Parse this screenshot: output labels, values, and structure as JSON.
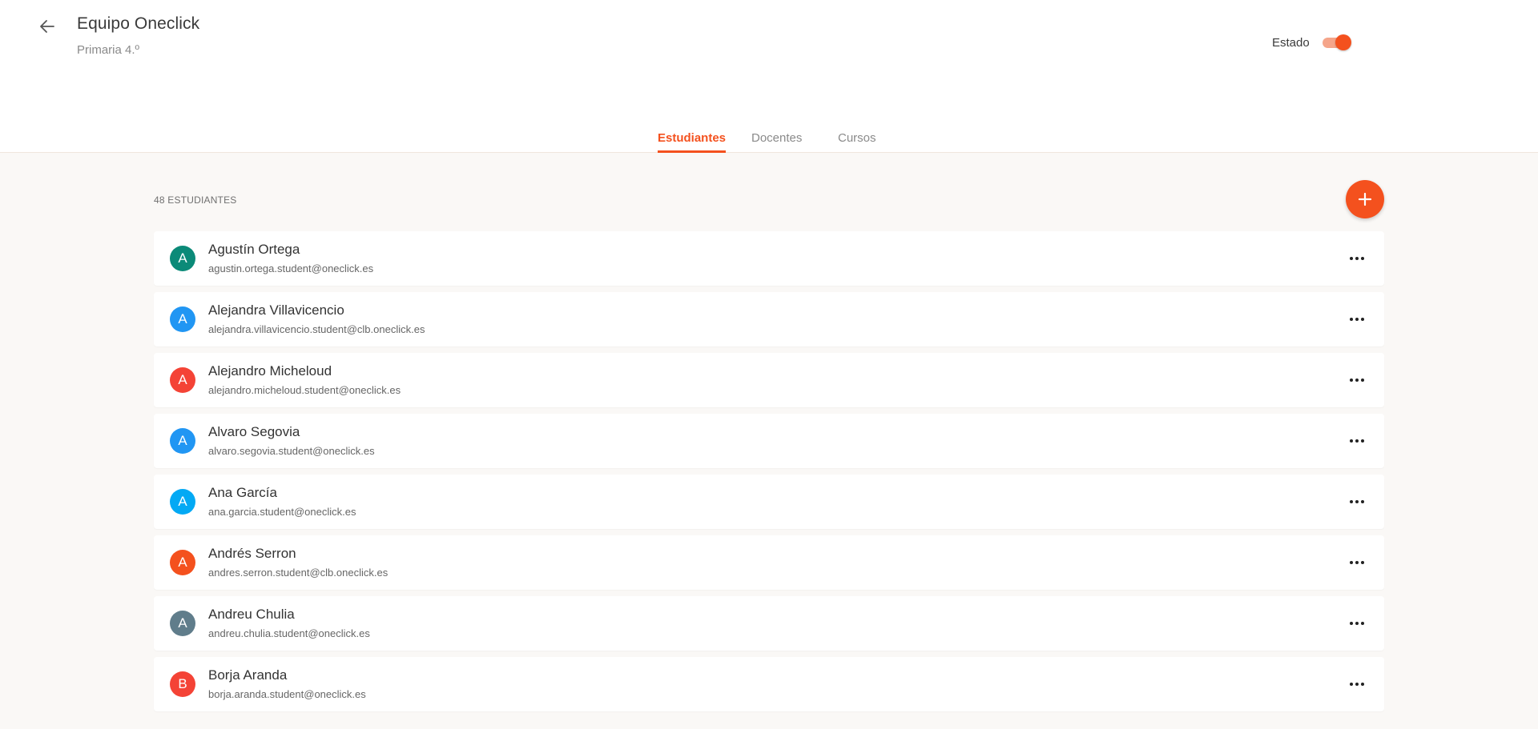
{
  "header": {
    "title": "Equipo Oneclick",
    "subtitle": "Primaria 4.º",
    "estado_label": "Estado",
    "estado_on": true
  },
  "tabs": [
    {
      "label": "Estudiantes",
      "active": true
    },
    {
      "label": "Docentes",
      "active": false
    },
    {
      "label": "Cursos",
      "active": false
    }
  ],
  "list": {
    "count_label": "48 ESTUDIANTES",
    "students": [
      {
        "initial": "A",
        "name": "Agustín Ortega",
        "email": "agustin.ortega.student@oneclick.es",
        "color": "#0b8a78"
      },
      {
        "initial": "A",
        "name": "Alejandra Villavicencio",
        "email": "alejandra.villavicencio.student@clb.oneclick.es",
        "color": "#2196f3"
      },
      {
        "initial": "A",
        "name": "Alejandro Micheloud",
        "email": "alejandro.micheloud.student@oneclick.es",
        "color": "#f44336"
      },
      {
        "initial": "A",
        "name": "Alvaro Segovia",
        "email": "alvaro.segovia.student@oneclick.es",
        "color": "#2196f3"
      },
      {
        "initial": "A",
        "name": "Ana García",
        "email": "ana.garcia.student@oneclick.es",
        "color": "#03a9f4"
      },
      {
        "initial": "A",
        "name": "Andrés Serron",
        "email": "andres.serron.student@clb.oneclick.es",
        "color": "#f4511e"
      },
      {
        "initial": "A",
        "name": "Andreu Chulia",
        "email": "andreu.chulia.student@oneclick.es",
        "color": "#607d8b"
      },
      {
        "initial": "B",
        "name": "Borja Aranda",
        "email": "borja.aranda.student@oneclick.es",
        "color": "#f44336"
      }
    ]
  },
  "icons": {
    "back": "arrow-left-icon",
    "add": "plus-icon",
    "more": "more-horizontal-icon"
  },
  "colors": {
    "accent": "#f4511e"
  }
}
